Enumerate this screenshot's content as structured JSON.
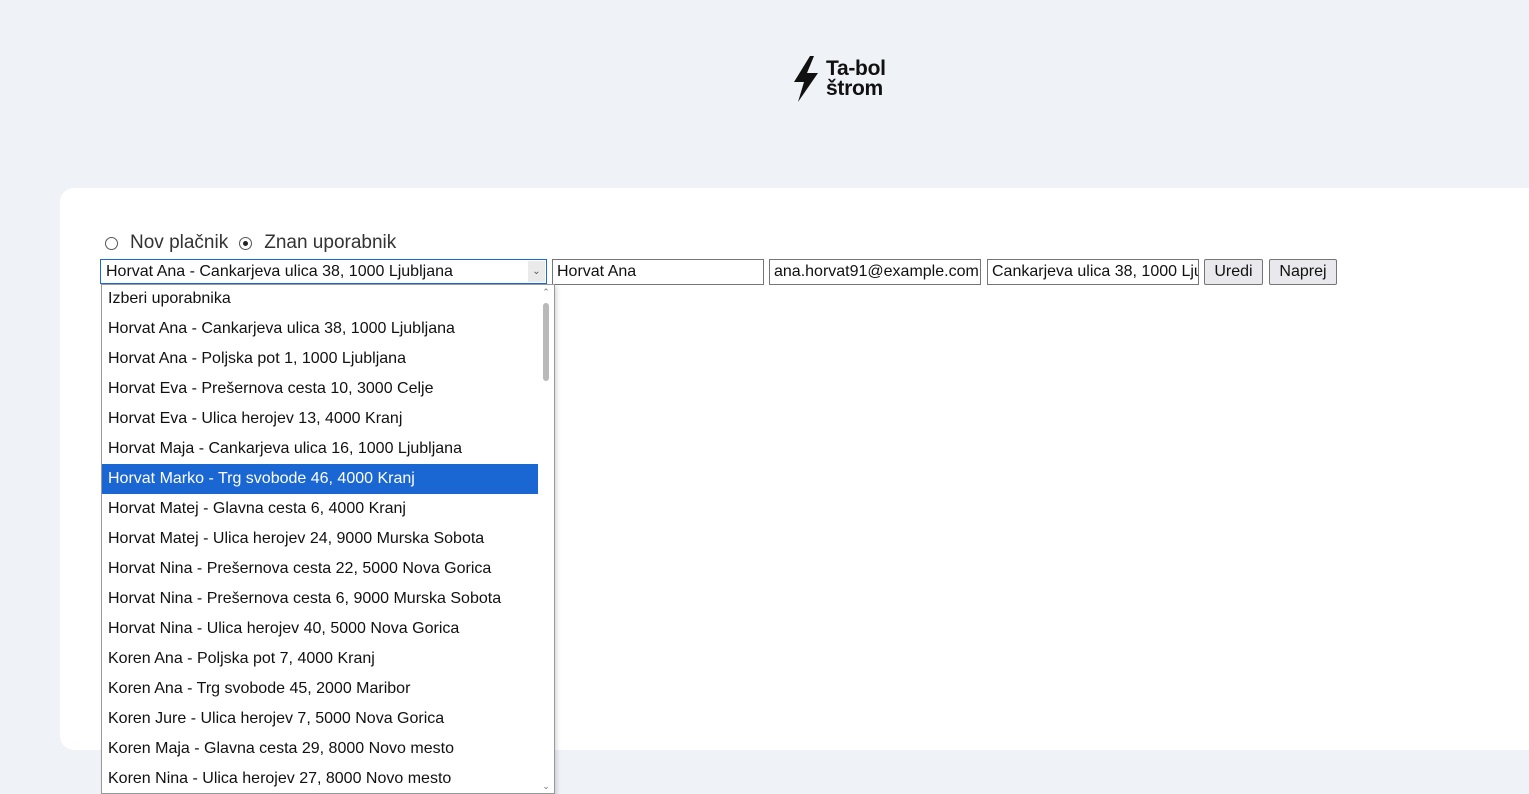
{
  "brand": {
    "logo_line1": "Ta-bol",
    "logo_line2": "štrom"
  },
  "payer_type": {
    "options": [
      {
        "label": "Nov plačnik",
        "checked": false
      },
      {
        "label": "Znan uporabnik",
        "checked": true
      }
    ]
  },
  "form": {
    "user_select_value": "Horvat Ana - Cankarjeva ulica 38, 1000 Ljubljana",
    "name_value": "Horvat Ana",
    "email_value": "ana.horvat91@example.com",
    "address_value": "Cankarjeva ulica 38, 1000 Ljubljana",
    "edit_button": "Uredi",
    "next_button": "Naprej"
  },
  "dropdown": {
    "items": [
      "Izberi uporabnika",
      "Horvat Ana - Cankarjeva ulica 38, 1000 Ljubljana",
      "Horvat Ana - Poljska pot 1, 1000 Ljubljana",
      "Horvat Eva - Prešernova cesta 10, 3000 Celje",
      "Horvat Eva - Ulica herojev 13, 4000 Kranj",
      "Horvat Maja - Cankarjeva ulica 16, 1000 Ljubljana",
      "Horvat Marko - Trg svobode 46, 4000 Kranj",
      "Horvat Matej - Glavna cesta 6, 4000 Kranj",
      "Horvat Matej - Ulica herojev 24, 9000 Murska Sobota",
      "Horvat Nina - Prešernova cesta 22, 5000 Nova Gorica",
      "Horvat Nina - Prešernova cesta 6, 9000 Murska Sobota",
      "Horvat Nina - Ulica herojev 40, 5000 Nova Gorica",
      "Koren Ana - Poljska pot 7, 4000 Kranj",
      "Koren Ana - Trg svobode 45, 2000 Maribor",
      "Koren Jure - Ulica herojev 7, 5000 Nova Gorica",
      "Koren Maja - Glavna cesta 29, 8000 Novo mesto",
      "Koren Nina - Ulica herojev 27, 8000 Novo mesto"
    ],
    "highlighted_item": "Horvat Marko - Trg svobode 46, 4000 Kranj"
  }
}
